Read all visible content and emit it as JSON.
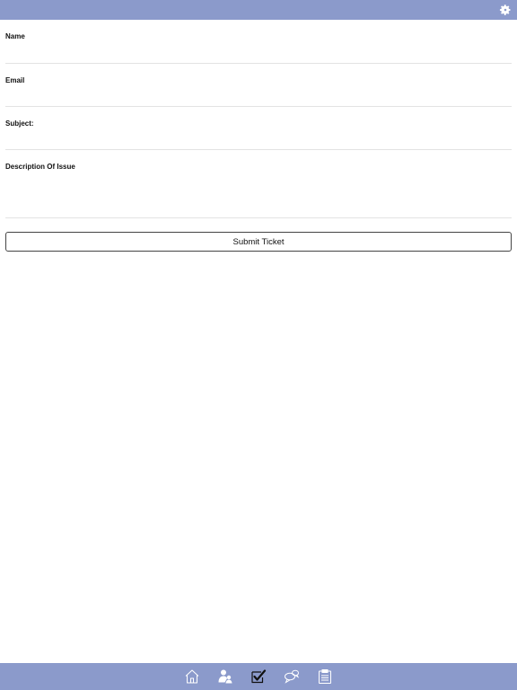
{
  "colors": {
    "bar": "#8b9acb",
    "icon": "#ffffff",
    "active_icon": "#111111"
  },
  "header": {
    "settings_icon": "gear-icon"
  },
  "form": {
    "name_label": "Name",
    "email_label": "Email",
    "subject_label": "Subject:",
    "description_label": "Description Of Issue",
    "name_value": "",
    "email_value": "",
    "subject_value": "",
    "description_value": ""
  },
  "submit_label": "Submit Ticket",
  "tabbar": {
    "items": [
      {
        "icon": "home-icon",
        "active": false
      },
      {
        "icon": "people-icon",
        "active": false
      },
      {
        "icon": "checkbox-icon",
        "active": true
      },
      {
        "icon": "chat-icon",
        "active": false
      },
      {
        "icon": "clipboard-icon",
        "active": false
      }
    ]
  }
}
